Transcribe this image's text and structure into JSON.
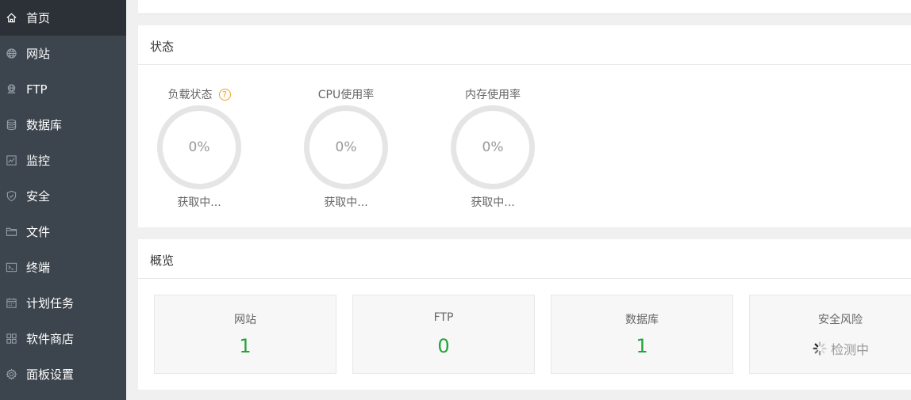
{
  "sidebar": {
    "items": [
      {
        "label": "首页",
        "icon": "home-icon",
        "active": true
      },
      {
        "label": "网站",
        "icon": "globe-icon"
      },
      {
        "label": "FTP",
        "icon": "ftp-icon"
      },
      {
        "label": "数据库",
        "icon": "database-icon"
      },
      {
        "label": "监控",
        "icon": "monitor-icon"
      },
      {
        "label": "安全",
        "icon": "shield-icon"
      },
      {
        "label": "文件",
        "icon": "folder-icon"
      },
      {
        "label": "终端",
        "icon": "terminal-icon"
      },
      {
        "label": "计划任务",
        "icon": "calendar-icon"
      },
      {
        "label": "软件商店",
        "icon": "grid-icon"
      },
      {
        "label": "面板设置",
        "icon": "gear-icon"
      }
    ],
    "colors": {
      "background": "#3c444d",
      "active_background": "#2c3138",
      "text": "#ffffff"
    }
  },
  "status": {
    "title": "状态",
    "gauges": [
      {
        "label": "负载状态",
        "value": "0%",
        "status": "获取中...",
        "has_help": true
      },
      {
        "label": "CPU使用率",
        "value": "0%",
        "status": "获取中..."
      },
      {
        "label": "内存使用率",
        "value": "0%",
        "status": "获取中..."
      }
    ],
    "help_icon_glyph": "?"
  },
  "overview": {
    "title": "概览",
    "cards": [
      {
        "title": "网站",
        "value": "1"
      },
      {
        "title": "FTP",
        "value": "0"
      },
      {
        "title": "数据库",
        "value": "1"
      },
      {
        "title": "安全风险",
        "checking": "检测中"
      }
    ],
    "value_color": "#20a53a"
  }
}
